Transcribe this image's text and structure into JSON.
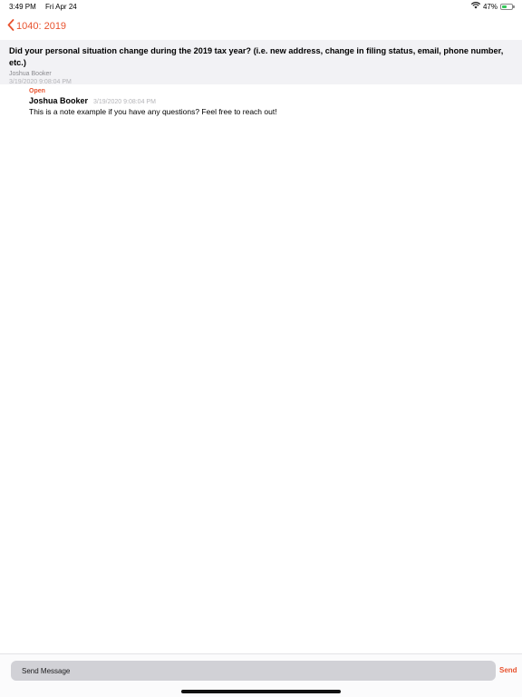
{
  "status_bar": {
    "time": "3:49 PM",
    "date": "Fri Apr 24",
    "battery_percent": "47%",
    "battery_level": 0.47
  },
  "nav": {
    "back_label": "1040: 2019"
  },
  "question": {
    "text": "Did your personal situation change during the 2019 tax year? (i.e. new address, change in filing status, email, phone number, etc.)",
    "author": "Joshua Booker",
    "date": "3/19/2020 9:08:04 PM"
  },
  "note": {
    "status": "Open",
    "author": "Joshua Booker",
    "date": "3/19/2020 9:08:04 PM",
    "body": "This is a note example if you have any questions? Feel free to reach out!"
  },
  "composer": {
    "placeholder": "Send Message",
    "send_label": "Send"
  },
  "colors": {
    "accent": "#e8532f",
    "header_bg": "#f2f2f5",
    "input_bg": "#d1d1d6"
  }
}
